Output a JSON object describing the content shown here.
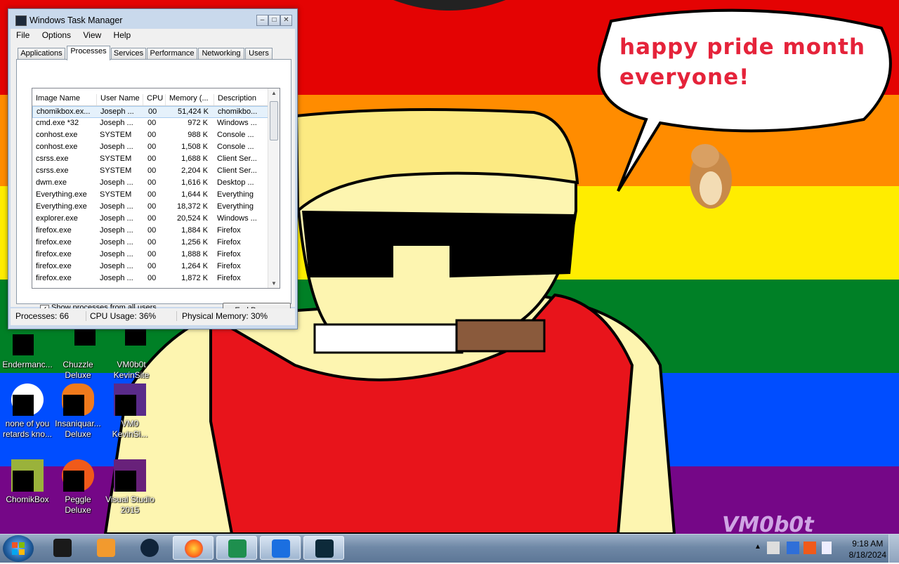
{
  "wallpaper": {
    "stripe_colors": [
      "#e40303",
      "#ff8c00",
      "#ffed00",
      "#008026",
      "#004dff",
      "#750787"
    ],
    "speech_bubble": {
      "line1": "happy pride month",
      "line2": "everyone!"
    },
    "watermark": "VM0b0t"
  },
  "desktop_icons": [
    {
      "id": "endermanc",
      "label1": "Endermanc...",
      "label2": ""
    },
    {
      "id": "chuzzle",
      "label1": "Chuzzle",
      "label2": "Deluxe"
    },
    {
      "id": "vm0b0t-kevinsite",
      "label1": "VM0b0t",
      "label2": "KevinSite"
    },
    {
      "id": "none-of-you",
      "label1": "none of you",
      "label2": "retards kno..."
    },
    {
      "id": "insaniquarium",
      "label1": "Insaniquar...",
      "label2": "Deluxe"
    },
    {
      "id": "vm0-kevinsi",
      "label1": "VM0",
      "label2": "KevinSi..."
    },
    {
      "id": "chomikbox",
      "label1": "ChomikBox",
      "label2": ""
    },
    {
      "id": "peggle",
      "label1": "Peggle",
      "label2": "Deluxe"
    },
    {
      "id": "visual-studio",
      "label1": "Visual Studio",
      "label2": "2015"
    }
  ],
  "task_manager": {
    "title": "Windows Task Manager",
    "menu": [
      "File",
      "Options",
      "View",
      "Help"
    ],
    "tabs": [
      "Applications",
      "Processes",
      "Services",
      "Performance",
      "Networking",
      "Users"
    ],
    "active_tab": "Processes",
    "columns": [
      "Image Name",
      "User Name",
      "CPU",
      "Memory (...",
      "Description"
    ],
    "rows": [
      [
        "chomikbox.ex...",
        "Joseph ...",
        "00",
        "51,424 K",
        "chomikbo..."
      ],
      [
        "cmd.exe *32",
        "Joseph ...",
        "00",
        "972 K",
        "Windows ..."
      ],
      [
        "conhost.exe",
        "SYSTEM",
        "00",
        "988 K",
        "Console ..."
      ],
      [
        "conhost.exe",
        "Joseph ...",
        "00",
        "1,508 K",
        "Console ..."
      ],
      [
        "csrss.exe",
        "SYSTEM",
        "00",
        "1,688 K",
        "Client Ser..."
      ],
      [
        "csrss.exe",
        "SYSTEM",
        "00",
        "2,204 K",
        "Client Ser..."
      ],
      [
        "dwm.exe",
        "Joseph ...",
        "00",
        "1,616 K",
        "Desktop ..."
      ],
      [
        "Everything.exe",
        "SYSTEM",
        "00",
        "1,644 K",
        "Everything"
      ],
      [
        "Everything.exe",
        "Joseph ...",
        "00",
        "18,372 K",
        "Everything"
      ],
      [
        "explorer.exe",
        "Joseph ...",
        "00",
        "20,524 K",
        "Windows ..."
      ],
      [
        "firefox.exe",
        "Joseph ...",
        "00",
        "1,884 K",
        "Firefox"
      ],
      [
        "firefox.exe",
        "Joseph ...",
        "00",
        "1,256 K",
        "Firefox"
      ],
      [
        "firefox.exe",
        "Joseph ...",
        "00",
        "1,888 K",
        "Firefox"
      ],
      [
        "firefox.exe",
        "Joseph ...",
        "00",
        "1,264 K",
        "Firefox"
      ],
      [
        "firefox.exe",
        "Joseph ...",
        "00",
        "1,872 K",
        "Firefox"
      ]
    ],
    "show_all_label": "Show processes from all users",
    "show_all_checked": true,
    "end_process_label": "End Process",
    "status": {
      "processes": "Processes: 66",
      "cpu": "CPU Usage: 36%",
      "memory": "Physical Memory: 30%"
    }
  },
  "taskbar": {
    "apps": [
      "terminal-app",
      "media-player-app",
      "steam-app",
      "firefox-app",
      "task-manager-app",
      "malwarebytes-app",
      "performance-monitor-app"
    ],
    "time": "9:18 AM",
    "date": "8/18/2024"
  }
}
